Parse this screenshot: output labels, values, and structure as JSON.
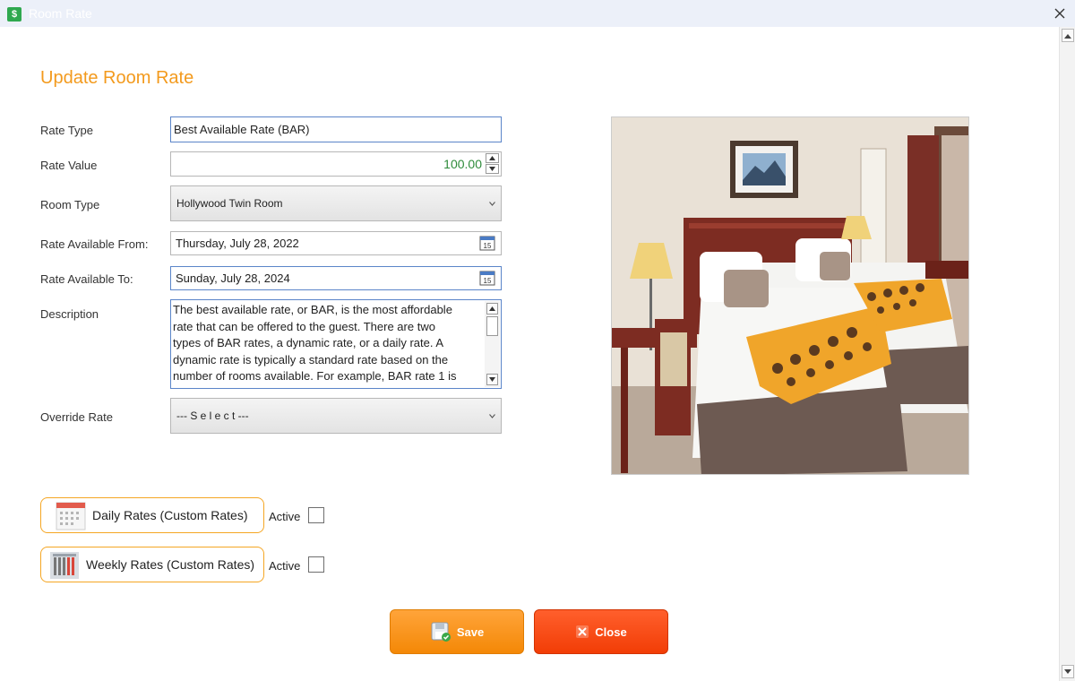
{
  "window": {
    "title": "Room Rate",
    "app_icon": "$"
  },
  "form": {
    "heading": "Update Room Rate",
    "rate_type": {
      "label": "Rate Type",
      "value": "Best Available Rate (BAR)"
    },
    "rate_value": {
      "label": "Rate Value",
      "value": "100.00"
    },
    "room_type": {
      "label": "Room Type",
      "value": "Hollywood Twin Room"
    },
    "rate_from": {
      "label": "Rate Available From:",
      "value": "Thursday, July 28, 2022",
      "calendar_day": "15"
    },
    "rate_to": {
      "label": "Rate Available To:",
      "value": "Sunday, July 28, 2024",
      "calendar_day": "15"
    },
    "description": {
      "label": "Description",
      "value": "The best available rate, or BAR, is the most affordable\nrate that can be offered to the guest. There are two\ntypes of BAR rates, a dynamic rate, or a daily rate. A\ndynamic rate is typically a standard rate based on the\nnumber of rooms available. For example, BAR rate 1 is"
    },
    "override_rate": {
      "label": "Override Rate",
      "value": "--- S e l e c t ---"
    }
  },
  "custom_rates": {
    "daily": {
      "label": "Daily Rates (Custom Rates)",
      "active_label": "Active",
      "active": false,
      "icon": "calendar-icon"
    },
    "weekly": {
      "label": "Weekly Rates (Custom Rates)",
      "active_label": "Active",
      "active": false,
      "icon": "weekly-calendar-icon"
    }
  },
  "actions": {
    "save_label": "Save",
    "close_label": "Close"
  },
  "colors": {
    "accent": "#f39a1d",
    "save": "#f48806",
    "close": "#f23d06",
    "value_green": "#2e8b3a"
  }
}
